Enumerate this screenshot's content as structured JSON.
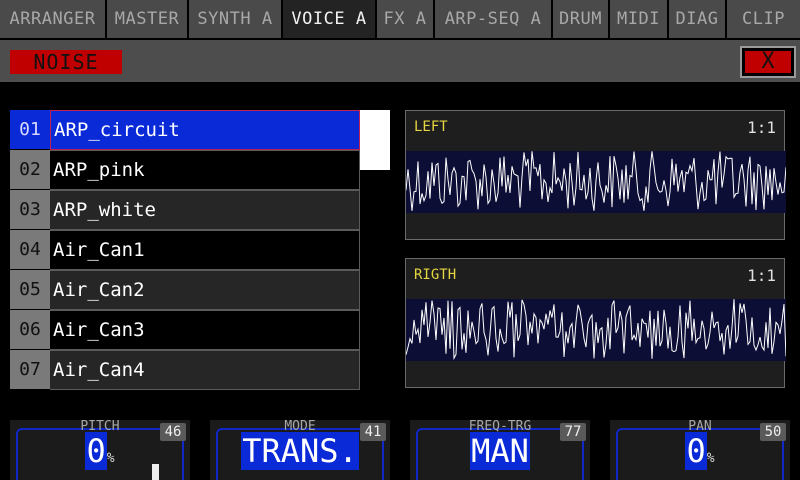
{
  "tabs": [
    {
      "label": "ARRANGER",
      "active": false
    },
    {
      "label": "MASTER",
      "active": false
    },
    {
      "label": "SYNTH A",
      "active": false
    },
    {
      "label": "VOICE A",
      "active": true
    },
    {
      "label": "FX A",
      "active": false
    },
    {
      "label": "ARP-SEQ A",
      "active": false
    },
    {
      "label": "DRUM",
      "active": false
    },
    {
      "label": "MIDI",
      "active": false
    },
    {
      "label": "DIAG",
      "active": false
    },
    {
      "label": "CLIP",
      "active": false
    }
  ],
  "header": {
    "title": "NOISE",
    "close_label": "X"
  },
  "list": {
    "items": [
      {
        "num": "01",
        "name": "ARP_circuit",
        "selected": true
      },
      {
        "num": "02",
        "name": "ARP_pink",
        "selected": false
      },
      {
        "num": "03",
        "name": "ARP_white",
        "selected": false
      },
      {
        "num": "04",
        "name": "Air_Can1",
        "selected": false
      },
      {
        "num": "05",
        "name": "Air_Can2",
        "selected": false
      },
      {
        "num": "06",
        "name": "Air_Can3",
        "selected": false
      },
      {
        "num": "07",
        "name": "Air_Can4",
        "selected": false
      }
    ]
  },
  "waves": {
    "left": {
      "label": "LEFT",
      "zoom": "1:1"
    },
    "right": {
      "label": "RIGTH",
      "zoom": "1:1"
    }
  },
  "knobs": {
    "pitch": {
      "label": "PITCH",
      "cc": "46",
      "value": "0",
      "unit": "%"
    },
    "mode": {
      "label": "MODE",
      "cc": "41",
      "value": "TRANS."
    },
    "freq_trg": {
      "label": "FREQ-TRG",
      "cc": "77",
      "value": "MAN"
    },
    "pan": {
      "label": "PAN",
      "cc": "50",
      "value": "0",
      "unit": "%"
    }
  },
  "colors": {
    "accent_blue": "#0a2ad8",
    "alert_red": "#c00000",
    "wave_label": "#e6d640"
  }
}
